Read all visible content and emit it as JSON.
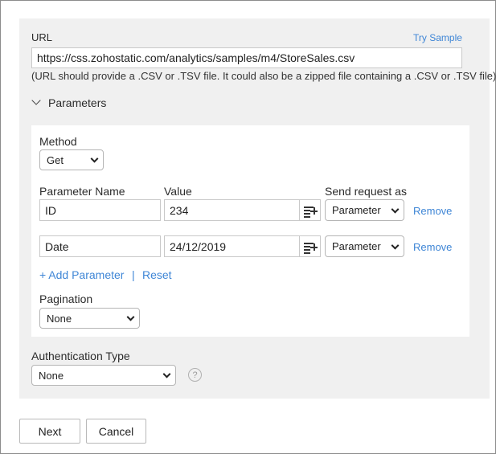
{
  "url_section": {
    "label": "URL",
    "try_sample": "Try Sample",
    "value": "https://css.zohostatic.com/analytics/samples/m4/StoreSales.csv",
    "hint": "(URL should provide a .CSV or .TSV file. It could also be a zipped file containing a .CSV or .TSV file)"
  },
  "parameters": {
    "toggle_label": "Parameters",
    "method_label": "Method",
    "method_value": "Get",
    "col_name": "Parameter Name",
    "col_value": "Value",
    "col_send": "Send request as",
    "rows": [
      {
        "name": "ID",
        "value": "234",
        "send_as": "Parameter",
        "remove": "Remove"
      },
      {
        "name": "Date",
        "value": "24/12/2019",
        "send_as": "Parameter",
        "remove": "Remove"
      }
    ],
    "add_param": "+ Add Parameter",
    "separator": "|",
    "reset": "Reset",
    "pagination_label": "Pagination",
    "pagination_value": "None"
  },
  "auth": {
    "label": "Authentication Type",
    "value": "None",
    "help_icon": "?"
  },
  "footer": {
    "next": "Next",
    "cancel": "Cancel"
  },
  "icons": {
    "expand": "chevron-down-icon",
    "picker": "insert-variable-icon",
    "help": "help-circle-icon"
  }
}
